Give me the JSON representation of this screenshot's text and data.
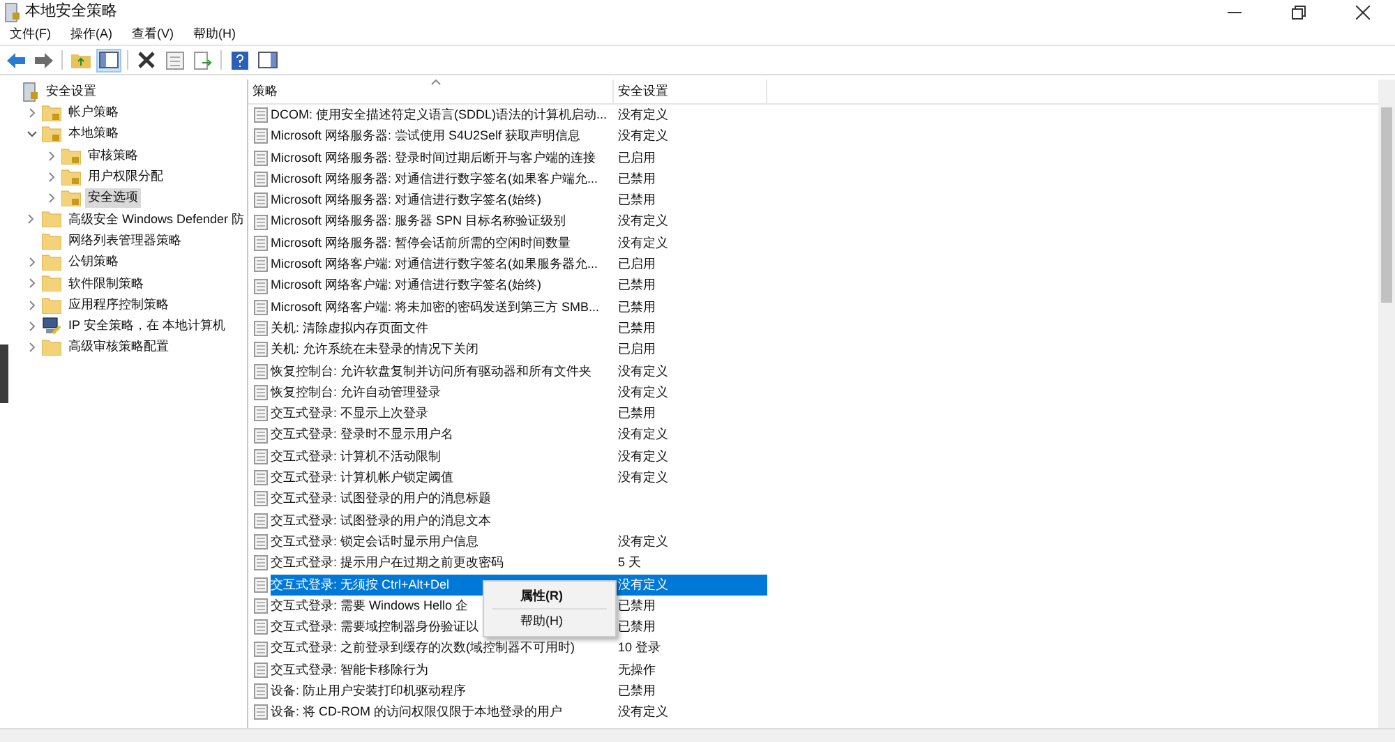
{
  "window": {
    "title": "本地安全策略"
  },
  "menu": [
    "文件(F)",
    "操作(A)",
    "查看(V)",
    "帮助(H)"
  ],
  "tree": [
    {
      "label": "安全设置",
      "kind": "root",
      "expandable": false,
      "expanded": true,
      "selected": false,
      "children": [
        {
          "label": "帐户策略",
          "kind": "folder",
          "expandable": true,
          "expanded": false,
          "selected": false
        },
        {
          "label": "本地策略",
          "kind": "folder",
          "expandable": true,
          "expanded": true,
          "selected": false,
          "children": [
            {
              "label": "审核策略",
              "kind": "folder",
              "expandable": true,
              "expanded": false,
              "selected": false
            },
            {
              "label": "用户权限分配",
              "kind": "folder",
              "expandable": true,
              "expanded": false,
              "selected": false
            },
            {
              "label": "安全选项",
              "kind": "folder",
              "expandable": true,
              "expanded": false,
              "selected": true
            }
          ]
        },
        {
          "label": "高级安全 Windows Defender 防",
          "kind": "plain",
          "expandable": true,
          "expanded": false,
          "selected": false
        },
        {
          "label": "网络列表管理器策略",
          "kind": "plain",
          "expandable": false,
          "selected": false
        },
        {
          "label": "公钥策略",
          "kind": "plain",
          "expandable": true,
          "expanded": false,
          "selected": false
        },
        {
          "label": "软件限制策略",
          "kind": "plain",
          "expandable": true,
          "expanded": false,
          "selected": false
        },
        {
          "label": "应用程序控制策略",
          "kind": "plain",
          "expandable": true,
          "expanded": false,
          "selected": false
        },
        {
          "label": "IP 安全策略，在 本地计算机",
          "kind": "ip",
          "expandable": true,
          "expanded": false,
          "selected": false
        },
        {
          "label": "高级审核策略配置",
          "kind": "plain",
          "expandable": true,
          "expanded": false,
          "selected": false
        }
      ]
    }
  ],
  "table": {
    "columns": [
      {
        "label": "策略",
        "sorted": true
      },
      {
        "label": "安全设置",
        "sorted": false
      }
    ],
    "rows": [
      {
        "policy": "DCOM: 使用安全描述符定义语言(SDDL)语法的计算机启动...",
        "setting": "没有定义",
        "selected": false
      },
      {
        "policy": "Microsoft 网络服务器: 尝试使用 S4U2Self 获取声明信息",
        "setting": "没有定义",
        "selected": false
      },
      {
        "policy": "Microsoft 网络服务器: 登录时间过期后断开与客户端的连接",
        "setting": "已启用",
        "selected": false
      },
      {
        "policy": "Microsoft 网络服务器: 对通信进行数字签名(如果客户端允...",
        "setting": "已禁用",
        "selected": false
      },
      {
        "policy": "Microsoft 网络服务器: 对通信进行数字签名(始终)",
        "setting": "已禁用",
        "selected": false
      },
      {
        "policy": "Microsoft 网络服务器: 服务器 SPN 目标名称验证级别",
        "setting": "没有定义",
        "selected": false
      },
      {
        "policy": "Microsoft 网络服务器: 暂停会话前所需的空闲时间数量",
        "setting": "没有定义",
        "selected": false
      },
      {
        "policy": "Microsoft 网络客户端: 对通信进行数字签名(如果服务器允...",
        "setting": "已启用",
        "selected": false
      },
      {
        "policy": "Microsoft 网络客户端: 对通信进行数字签名(始终)",
        "setting": "已禁用",
        "selected": false
      },
      {
        "policy": "Microsoft 网络客户端: 将未加密的密码发送到第三方 SMB...",
        "setting": "已禁用",
        "selected": false
      },
      {
        "policy": "关机: 清除虚拟内存页面文件",
        "setting": "已禁用",
        "selected": false
      },
      {
        "policy": "关机: 允许系统在未登录的情况下关闭",
        "setting": "已启用",
        "selected": false
      },
      {
        "policy": "恢复控制台: 允许软盘复制并访问所有驱动器和所有文件夹",
        "setting": "没有定义",
        "selected": false
      },
      {
        "policy": "恢复控制台: 允许自动管理登录",
        "setting": "没有定义",
        "selected": false
      },
      {
        "policy": "交互式登录: 不显示上次登录",
        "setting": "已禁用",
        "selected": false
      },
      {
        "policy": "交互式登录: 登录时不显示用户名",
        "setting": "没有定义",
        "selected": false
      },
      {
        "policy": "交互式登录: 计算机不活动限制",
        "setting": "没有定义",
        "selected": false
      },
      {
        "policy": "交互式登录: 计算机帐户锁定阈值",
        "setting": "没有定义",
        "selected": false
      },
      {
        "policy": "交互式登录: 试图登录的用户的消息标题",
        "selected": false
      },
      {
        "policy": "交互式登录: 试图登录的用户的消息文本",
        "selected": false
      },
      {
        "policy": "交互式登录: 锁定会话时显示用户信息",
        "setting": "没有定义",
        "selected": false
      },
      {
        "policy": "交互式登录: 提示用户在过期之前更改密码",
        "setting": "5 天",
        "selected": false
      },
      {
        "policy": "交互式登录: 无须按 Ctrl+Alt+Del",
        "setting": "没有定义",
        "selected": true
      },
      {
        "policy": "交互式登录: 需要 Windows Hello 企",
        "setting": "已禁用",
        "selected": false
      },
      {
        "policy": "交互式登录: 需要域控制器身份验证以",
        "setting": "已禁用",
        "selected": false
      },
      {
        "policy": "交互式登录: 之前登录到缓存的次数(域控制器不可用时)",
        "setting": "10 登录",
        "selected": false
      },
      {
        "policy": "交互式登录: 智能卡移除行为",
        "setting": "无操作",
        "selected": false
      },
      {
        "policy": "设备: 防止用户安装打印机驱动程序",
        "setting": "已禁用",
        "selected": false
      },
      {
        "policy": "设备: 将 CD-ROM 的访问权限仅限于本地登录的用户",
        "setting": "没有定义",
        "selected": false
      }
    ]
  },
  "context_menu": [
    {
      "label": "属性(R)",
      "bold": true
    },
    {
      "label": "帮助(H)",
      "bold": false
    }
  ]
}
